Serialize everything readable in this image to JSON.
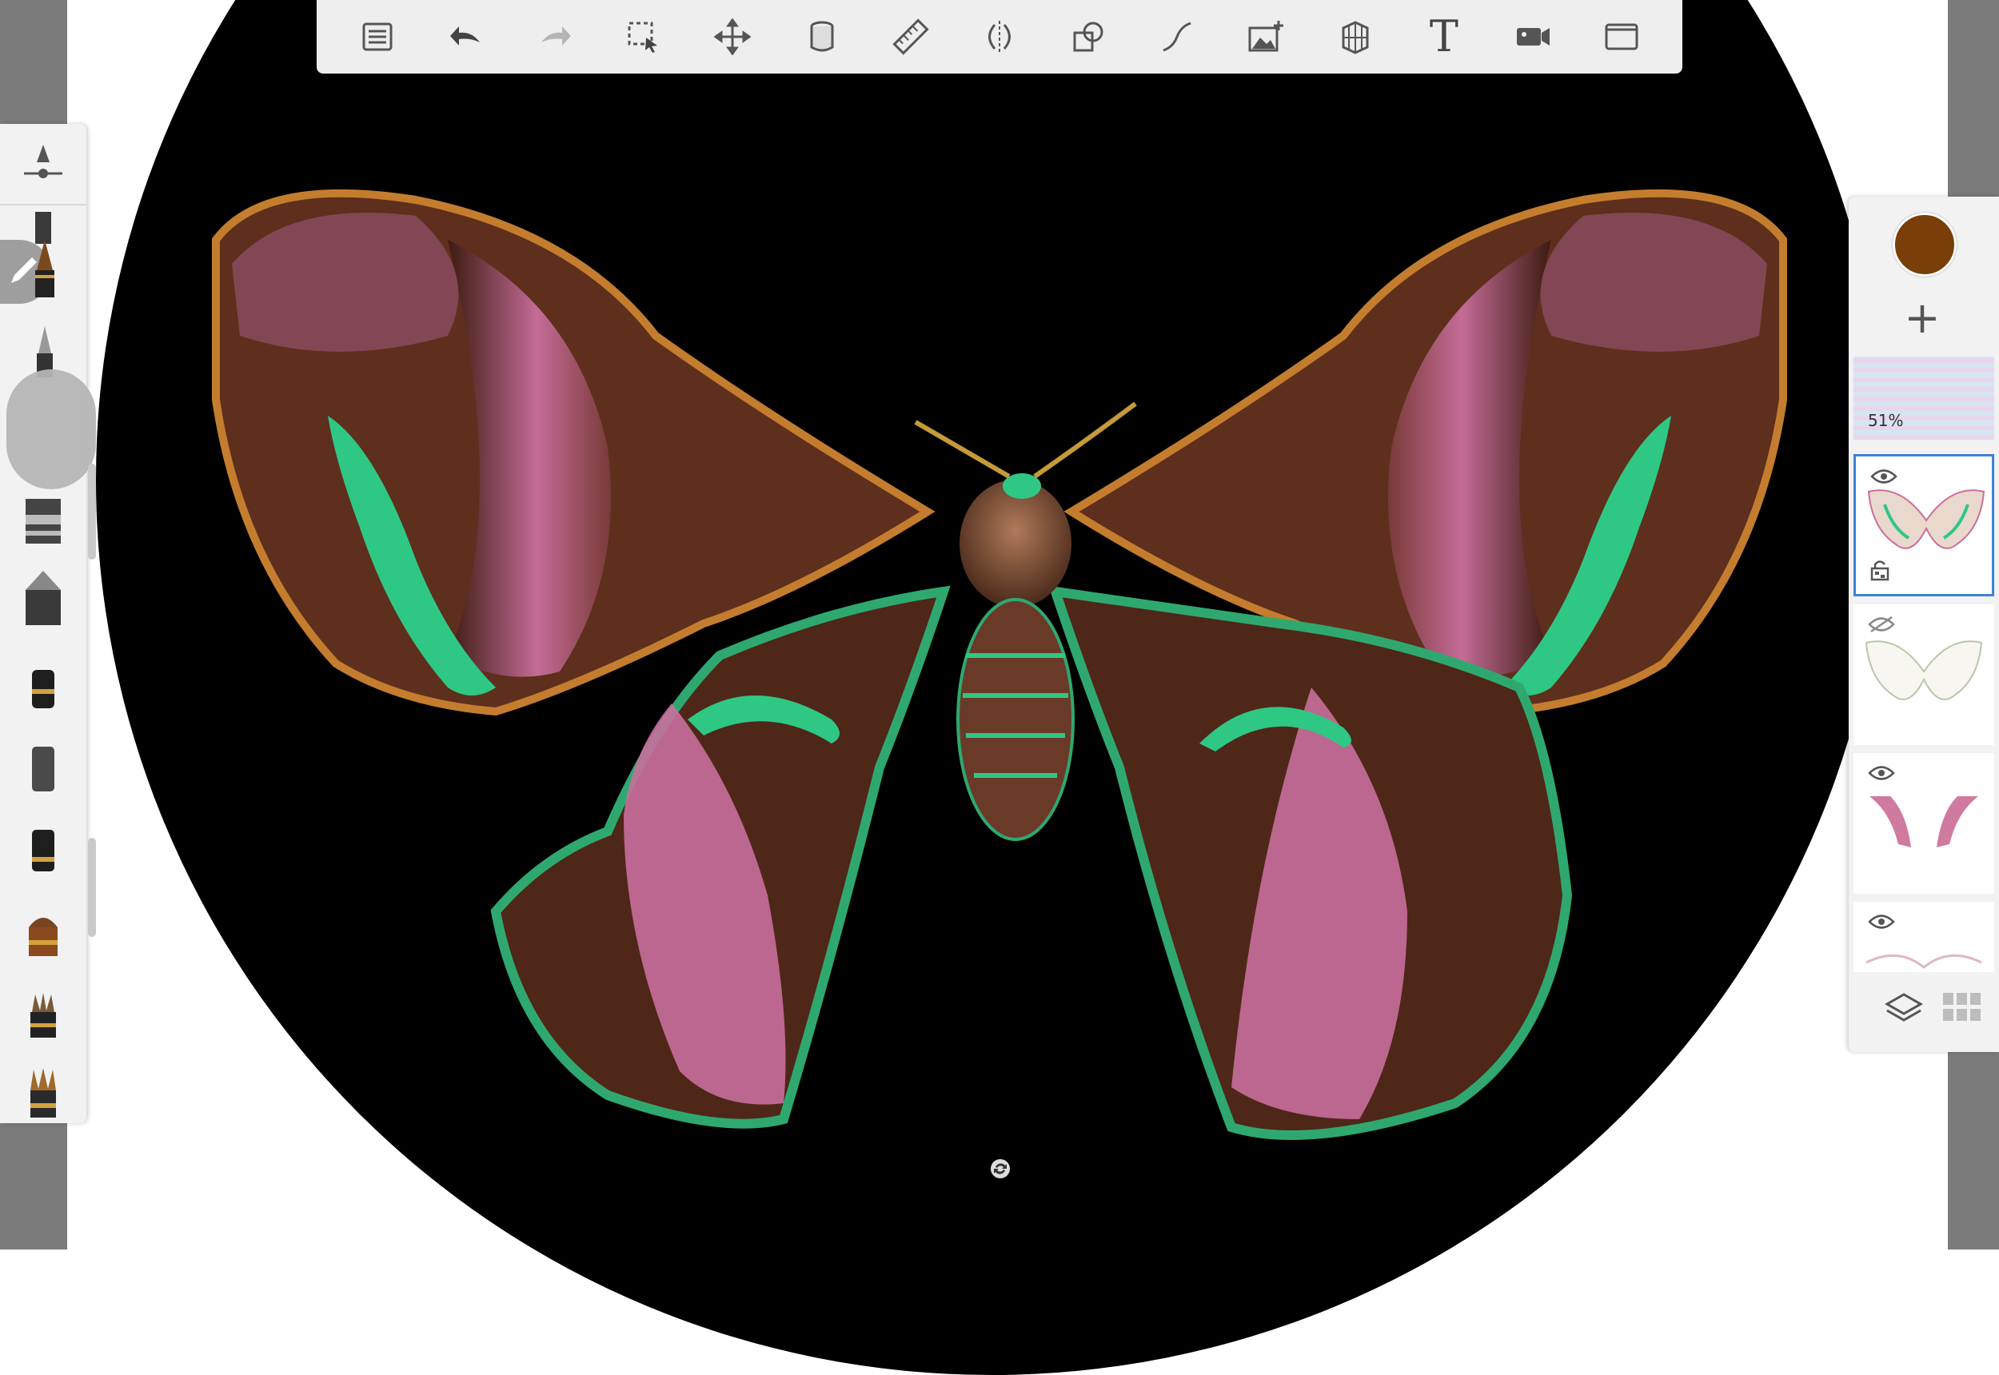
{
  "toolbar": {
    "buttons": [
      {
        "id": "list",
        "icon": "list-icon"
      },
      {
        "id": "undo",
        "icon": "undo-icon"
      },
      {
        "id": "redo",
        "icon": "redo-icon"
      },
      {
        "id": "selection",
        "icon": "selection-icon"
      },
      {
        "id": "transform",
        "icon": "move-arrows-icon"
      },
      {
        "id": "fill",
        "icon": "paint-bucket-icon"
      },
      {
        "id": "ruler",
        "icon": "ruler-icon"
      },
      {
        "id": "symmetry",
        "icon": "symmetry-icon"
      },
      {
        "id": "shapes",
        "icon": "shapes-icon"
      },
      {
        "id": "curve",
        "icon": "stroke-curve-icon"
      },
      {
        "id": "insert-image",
        "icon": "insert-image-icon"
      },
      {
        "id": "perspective",
        "icon": "perspective-grid-icon"
      },
      {
        "id": "text",
        "icon": "text-icon",
        "glyph": "T"
      },
      {
        "id": "record",
        "icon": "video-camera-icon"
      },
      {
        "id": "fullscreen",
        "icon": "fullscreen-icon"
      }
    ]
  },
  "brushes": [
    "brush-size-opacity-icon",
    "pencil-brush",
    "fineliner-brush",
    "airbrush-brush",
    "marker-brush",
    "chisel-brush",
    "felt-pen-brush",
    "soft-brush",
    "paint-brush",
    "round-brush",
    "fan-brush",
    "flat-brush"
  ],
  "layers": {
    "current_color": "#7a3e08",
    "add_label": "+",
    "background_opacity": "51%",
    "items": [
      {
        "name": "layer-moth-color",
        "visible": true,
        "selected": true,
        "locked_alpha": true
      },
      {
        "name": "layer-moth-lineart",
        "visible": false,
        "selected": false
      },
      {
        "name": "layer-moth-pink",
        "visible": true,
        "selected": false
      },
      {
        "name": "layer-moth-sketch",
        "visible": true,
        "selected": false
      }
    ]
  },
  "colors": {
    "moth_pink": "#c96f9c",
    "moth_green": "#2fc784",
    "moth_brown": "#6a3a1a",
    "moth_orange": "#c47d2e",
    "selection_blue": "#3e82d6"
  }
}
